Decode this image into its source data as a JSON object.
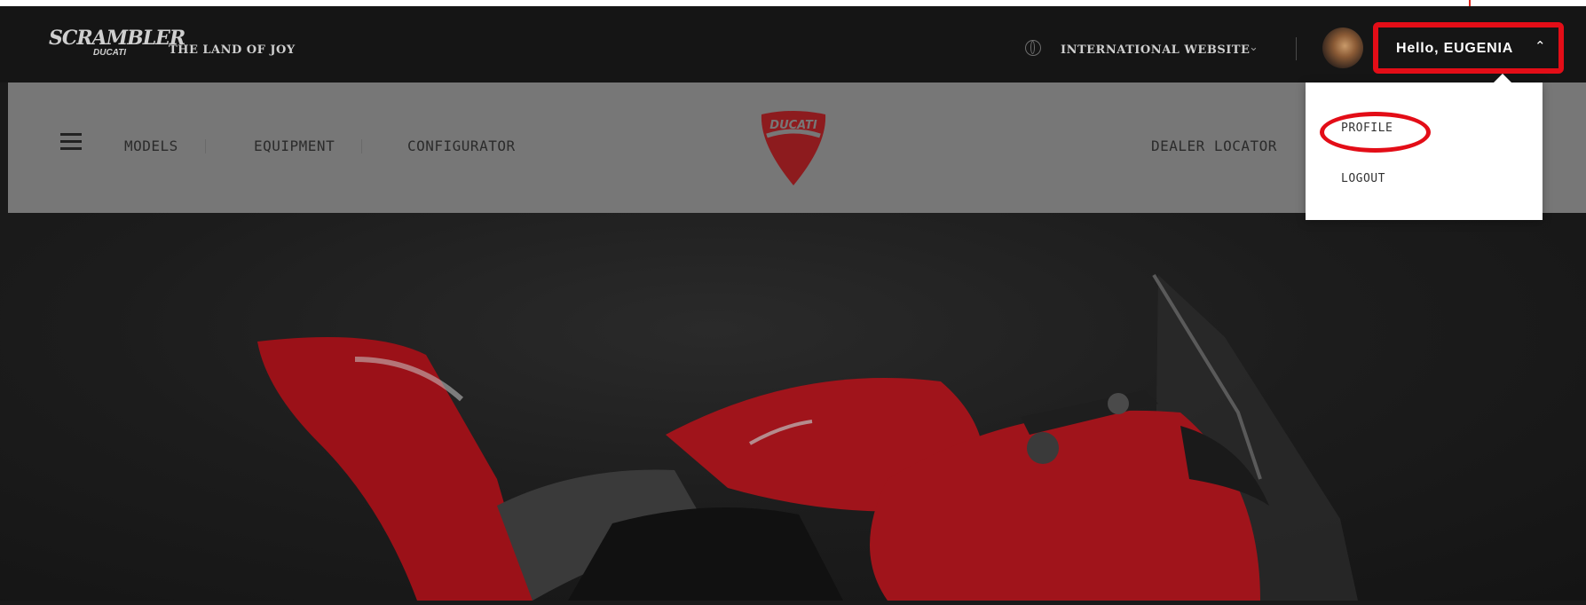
{
  "header": {
    "brand_main": "SCRAMBLER",
    "brand_sub": "DUCATI",
    "tagline": "THE LAND OF JOY",
    "intl_label": "INTERNATIONAL WEBSITE",
    "user_greeting": "Hello, EUGENIA"
  },
  "nav": {
    "items": [
      "MODELS",
      "EQUIPMENT",
      "CONFIGURATOR"
    ],
    "dealer": "DEALER LOCATOR",
    "logo_text": "DUCATI"
  },
  "user_menu": {
    "items": [
      "PROFILE",
      "LOGOUT"
    ]
  },
  "icons": {
    "menu": "hamburger-icon",
    "globe": "globe-icon",
    "chevron_down": "chevron-down-icon",
    "chevron_up": "chevron-up-icon"
  },
  "colors": {
    "brand_red": "#e30d17",
    "bike_red": "#a5121a",
    "nav_bg": "#777777",
    "top_bg": "#151515"
  }
}
